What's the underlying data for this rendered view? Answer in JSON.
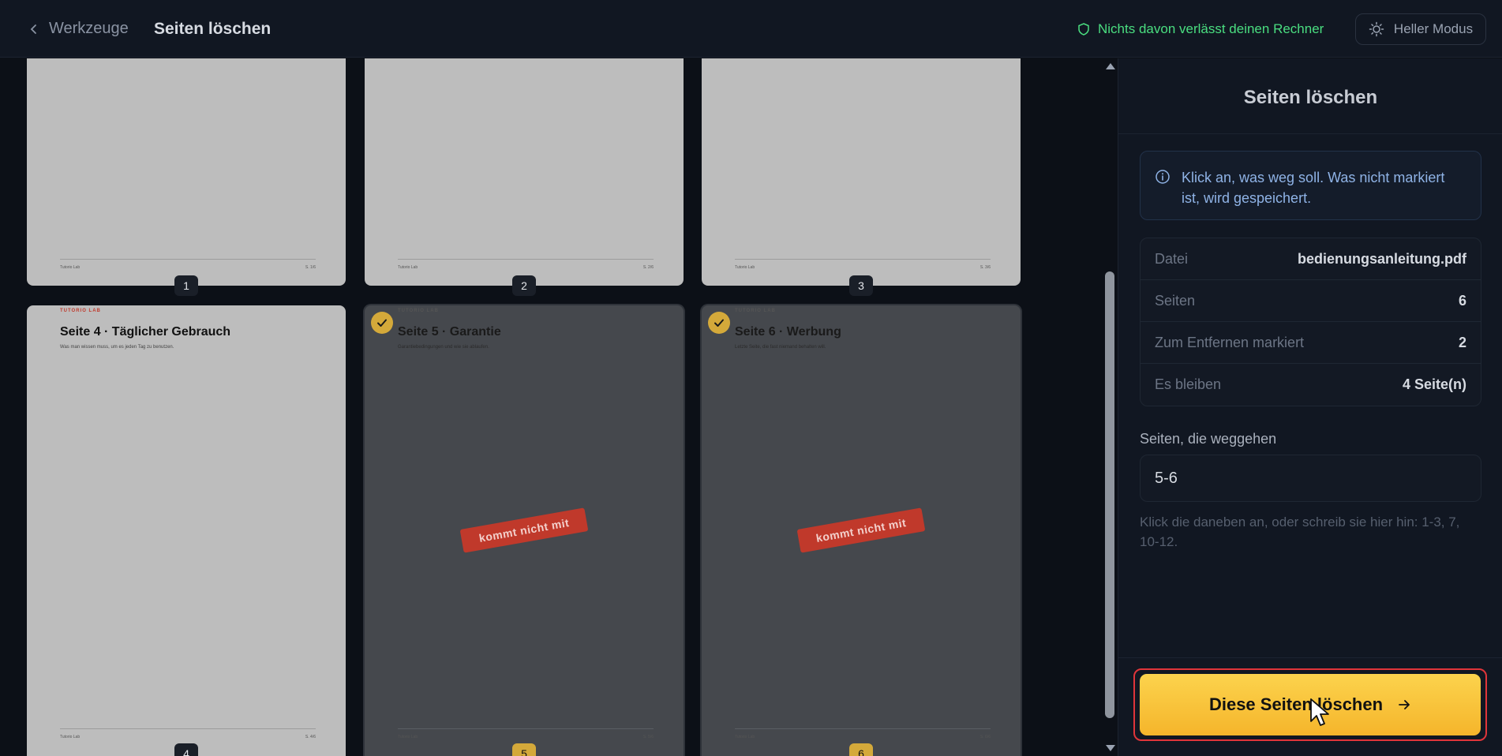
{
  "header": {
    "back_label": "Werkzeuge",
    "title": "Seiten löschen",
    "privacy_text": "Nichts davon verlässt deinen Rechner",
    "mode_label": "Heller Modus"
  },
  "pages": [
    {
      "number": "1",
      "marked": false,
      "brand": "",
      "title": "",
      "subtitle": "",
      "footer_left": "Tutorio Lab",
      "footer_right": "S. 1/6"
    },
    {
      "number": "2",
      "marked": false,
      "brand": "",
      "title": "",
      "subtitle": "",
      "footer_left": "Tutorio Lab",
      "footer_right": "S. 2/6"
    },
    {
      "number": "3",
      "marked": false,
      "brand": "",
      "title": "",
      "subtitle": "",
      "footer_left": "Tutorio Lab",
      "footer_right": "S. 3/6"
    },
    {
      "number": "4",
      "marked": false,
      "brand": "TUTORIO LAB",
      "title": "Seite 4 · Täglicher Gebrauch",
      "subtitle": "Was man wissen muss, um es jeden Tag zu benutzen.",
      "footer_left": "Tutorio Lab",
      "footer_right": "S. 4/6"
    },
    {
      "number": "5",
      "marked": true,
      "brand": "TUTORIO LAB",
      "title": "Seite 5 · Garantie",
      "subtitle": "Garantiebedingungen und wie sie ablaufen.",
      "footer_left": "Tutorio Lab",
      "footer_right": "S. 5/6",
      "stamp": "kommt nicht mit"
    },
    {
      "number": "6",
      "marked": true,
      "brand": "TUTORIO LAB",
      "title": "Seite 6 · Werbung",
      "subtitle": "Letzte Seite, die fast niemand behalten will.",
      "footer_left": "Tutorio Lab",
      "footer_right": "S. 6/6",
      "stamp": "kommt nicht mit"
    }
  ],
  "sidebar": {
    "title": "Seiten löschen",
    "info": "Klick an, was weg soll. Was nicht markiert ist, wird gespeichert.",
    "stats": [
      {
        "label": "Datei",
        "value": "bedienungsanleitung.pdf"
      },
      {
        "label": "Seiten",
        "value": "6"
      },
      {
        "label": "Zum Entfernen markiert",
        "value": "2"
      },
      {
        "label": "Es bleiben",
        "value": "4 Seite(n)"
      }
    ],
    "field_label": "Seiten, die weggehen",
    "field_value": "5-6",
    "hint": "Klick die daneben an, oder schreib sie hier hin: 1-3, 7, 10-12.",
    "cta_label": "Diese Seiten löschen"
  },
  "colors": {
    "accent": "#fcd34d",
    "privacy_green": "#4ade80",
    "stamp_red": "#c0392b",
    "highlight": "#e0353a"
  }
}
